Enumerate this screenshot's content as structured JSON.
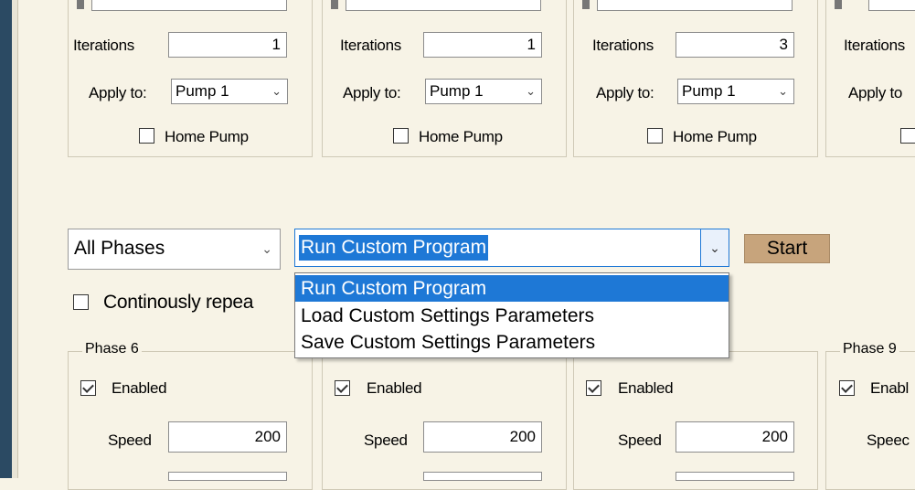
{
  "pump_groups": [
    {
      "iterations_label": "Iterations",
      "iterations_value": "1",
      "apply_label": "Apply to:",
      "apply_value": "Pump 1",
      "home_label": "Home Pump"
    },
    {
      "iterations_label": "Iterations",
      "iterations_value": "1",
      "apply_label": "Apply to:",
      "apply_value": "Pump 1",
      "home_label": "Home Pump"
    },
    {
      "iterations_label": "Iterations",
      "iterations_value": "3",
      "apply_label": "Apply to:",
      "apply_value": "Pump 1",
      "home_label": "Home Pump"
    },
    {
      "iterations_label": "Iterations",
      "apply_label": "Apply to",
      "home_label": ""
    }
  ],
  "phases_select": {
    "value": "All Phases"
  },
  "program_select": {
    "value": "Run Custom Program",
    "options": [
      "Run Custom Program",
      "Load Custom Settings Parameters",
      "Save  Custom Settings Parameters"
    ],
    "highlighted_index": 0
  },
  "start_button": {
    "label": "Start",
    "color": "#c7a47c"
  },
  "repeat_checkbox": {
    "label": "Continously repea",
    "checked": false
  },
  "phases": [
    {
      "title": "Phase 6",
      "enabled_label": "Enabled",
      "enabled": true,
      "speed_label": "Speed",
      "speed_value": "200"
    },
    {
      "title": "",
      "enabled_label": "Enabled",
      "enabled": true,
      "speed_label": "Speed",
      "speed_value": "200"
    },
    {
      "title": "",
      "enabled_label": "Enabled",
      "enabled": true,
      "speed_label": "Speed",
      "speed_value": "200"
    },
    {
      "title": "Phase 9",
      "enabled_label": "Enabl",
      "enabled": true,
      "speed_label": "Speec"
    }
  ],
  "colors": {
    "background": "#f7f3e6",
    "accent": "#1e78d6",
    "sidebar": "#2b4a63"
  },
  "icons": [
    "chevron-down-icon",
    "checkbox-icon",
    "checkmark-icon"
  ]
}
